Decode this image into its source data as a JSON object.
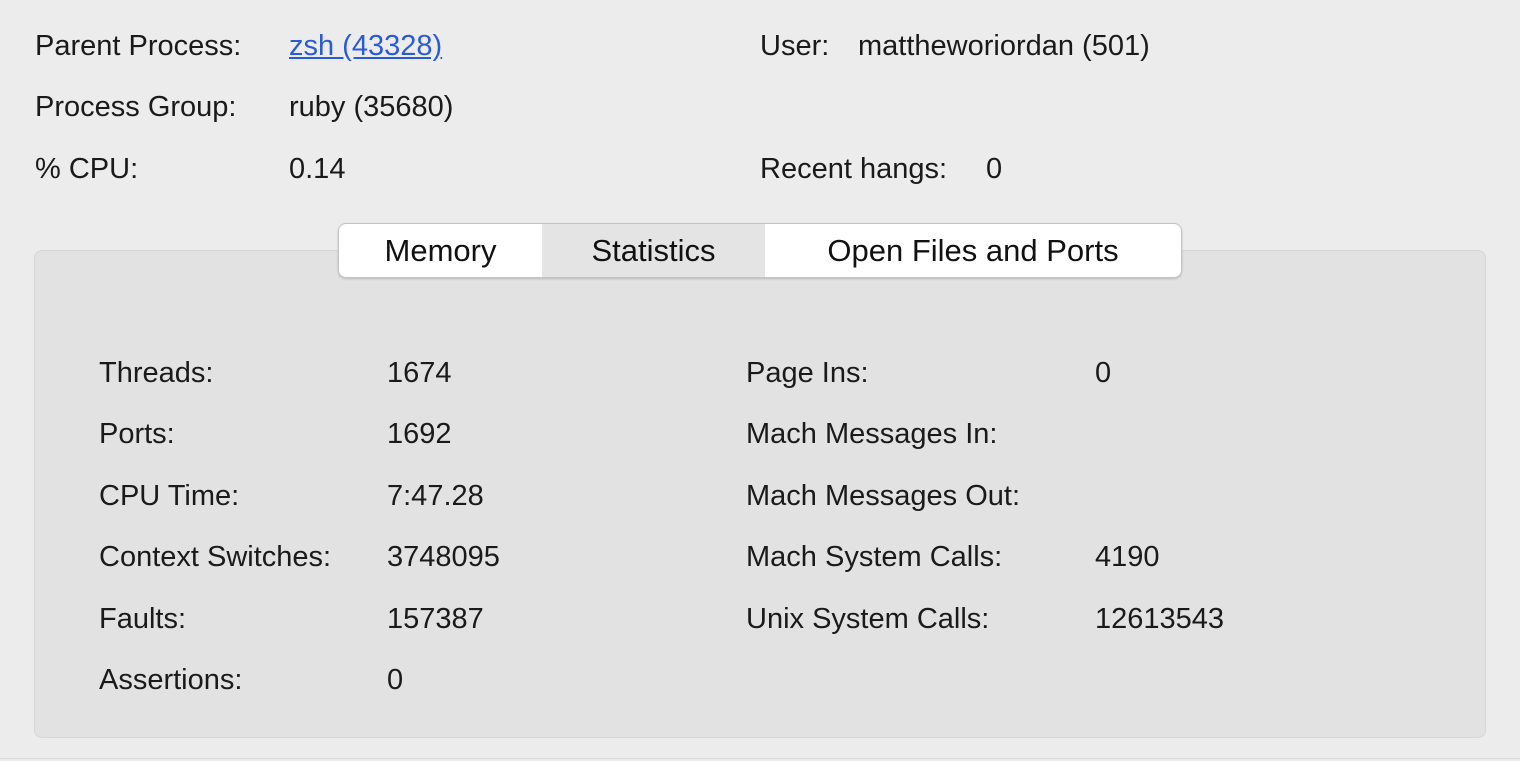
{
  "info": {
    "parent_process_label": "Parent Process:",
    "parent_process_value": "zsh (43328)",
    "user_label": "User:",
    "user_value": "mattheworiordan (501)",
    "process_group_label": "Process Group:",
    "process_group_value": "ruby (35680)",
    "cpu_label": "% CPU:",
    "cpu_value": "0.14",
    "recent_hangs_label": "Recent hangs:",
    "recent_hangs_value": "0"
  },
  "tabs": [
    {
      "label": "Memory",
      "selected": false
    },
    {
      "label": "Statistics",
      "selected": true
    },
    {
      "label": "Open Files and Ports",
      "selected": false
    }
  ],
  "stats_left": [
    {
      "label": "Threads:",
      "value": "1674"
    },
    {
      "label": "Ports:",
      "value": "1692"
    },
    {
      "label": "CPU Time:",
      "value": "7:47.28"
    },
    {
      "label": "Context Switches:",
      "value": "3748095"
    },
    {
      "label": "Faults:",
      "value": "157387"
    },
    {
      "label": "Assertions:",
      "value": "0"
    }
  ],
  "stats_right": [
    {
      "label": "Page Ins:",
      "value": "0"
    },
    {
      "label": "Mach Messages In:",
      "value": ""
    },
    {
      "label": "Mach Messages Out:",
      "value": ""
    },
    {
      "label": "Mach System Calls:",
      "value": "4190"
    },
    {
      "label": "Unix System Calls:",
      "value": "12613543"
    }
  ],
  "colors": {
    "background": "#ececec",
    "panel": "#e2e2e2",
    "link": "#2a5bd7",
    "selected_tab": "#e4e4e4"
  }
}
